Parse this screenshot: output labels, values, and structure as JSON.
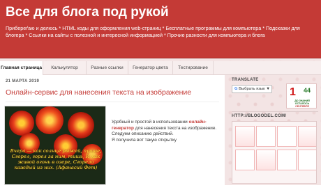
{
  "header": {
    "title": "Все для блога под рукой",
    "description": "Прибереґаю и делюсь * HTML коды для оформления web-страниц * Бесплатные программы для компьютера * Подсказки для блогера * Ссылки на сайты с полезной и интересной информацией * Прочие разности для компьютера и блога"
  },
  "tabs": [
    {
      "label": "Главная страница",
      "active": true
    },
    {
      "label": "Калькулятор"
    },
    {
      "label": "Разные ссылки"
    },
    {
      "label": "Генератор цвета"
    },
    {
      "label": "Тестирование"
    }
  ],
  "post": {
    "date": "21 МАРТА 2019",
    "title": "Онлайн-сервис для нанесения текста на изображение",
    "poem": "Вчера — как солнце рыжей, пущие, Сгорел, горел за ним, тишь, И как живой огонь в озере, Сгорела каждый из них. (Афанасий Фет)",
    "text_1": "Удобный и простой в использовании",
    "text_highlight": "онлайн-генератор",
    "text_2": "для нанесения текста на изображение.",
    "text_3": "Следуем описанию действий.",
    "text_4": "Я получила вот такую открытку"
  },
  "sidebar": {
    "translate_heading": "TRANSLATE",
    "translate_widget": "Выбрать язык ▼",
    "translate_brand": "G",
    "countdown_number": "1",
    "countdown_days": "44",
    "countdown_label": "ДО ЗНАНИЙ ОСТАЛОСЬ",
    "countdown_month": "СЕНТЯБРЯ",
    "link_heading": "HTTP://BLOGODEL.COM/"
  },
  "colors": {
    "header_bg": "#c43a36",
    "title_link": "#c43a36",
    "page_bg": "#f3e4e4"
  }
}
